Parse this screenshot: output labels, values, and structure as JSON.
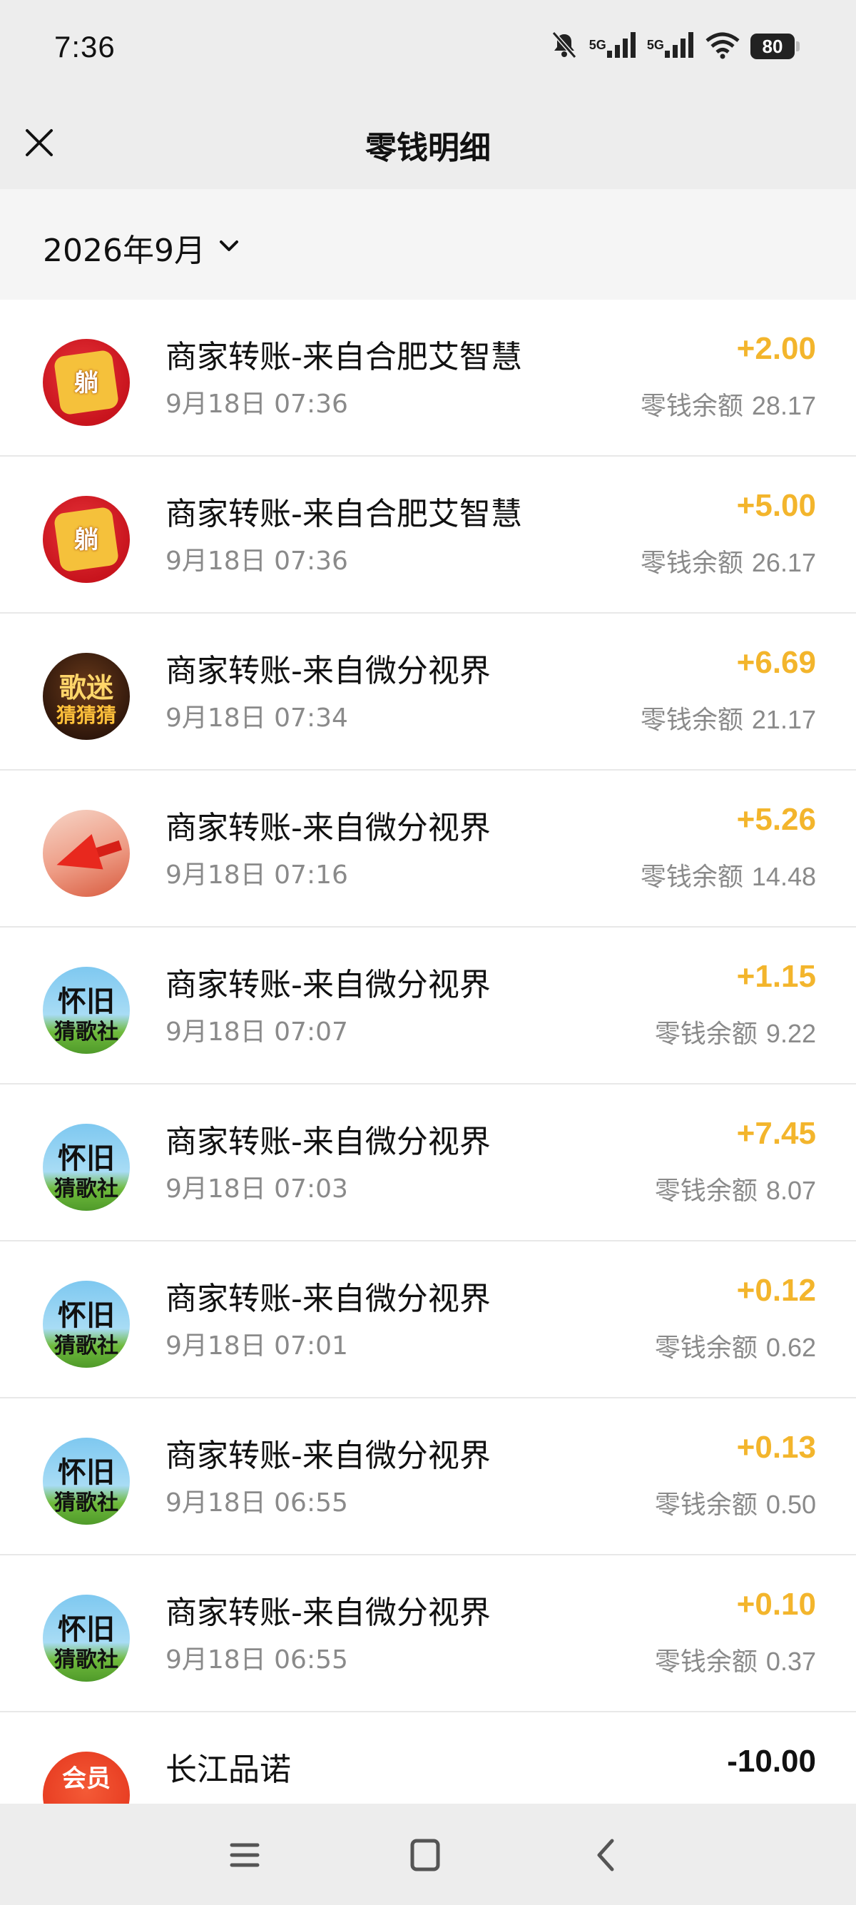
{
  "status_bar": {
    "time": "7:36",
    "network_1": "5G",
    "network_2": "5G",
    "battery": "80"
  },
  "header": {
    "title": "零钱明细"
  },
  "filter": {
    "month": "2026年9月"
  },
  "transactions": [
    {
      "title": "商家转账-来自合肥艾智慧",
      "time": "9月18日 07:36",
      "amount": "+2.00",
      "balance_label": "零钱余额",
      "balance": "28.17",
      "avatar": "red-game-logo",
      "avatar_text": "躺"
    },
    {
      "title": "商家转账-来自合肥艾智慧",
      "time": "9月18日 07:36",
      "amount": "+5.00",
      "balance_label": "零钱余额",
      "balance": "26.17",
      "avatar": "red-game-logo",
      "avatar_text": "躺"
    },
    {
      "title": "商家转账-来自微分视界",
      "time": "9月18日 07:34",
      "amount": "+6.69",
      "balance_label": "零钱余额",
      "balance": "21.17",
      "avatar": "gold-song-logo",
      "avatar_text_1": "歌迷",
      "avatar_text_2": "猜猜猜"
    },
    {
      "title": "商家转账-来自微分视界",
      "time": "9月18日 07:16",
      "amount": "+5.26",
      "balance_label": "零钱余额",
      "balance": "14.48",
      "avatar": "red-arrow-logo"
    },
    {
      "title": "商家转账-来自微分视界",
      "time": "9月18日 07:07",
      "amount": "+1.15",
      "balance_label": "零钱余额",
      "balance": "9.22",
      "avatar": "sky-song-logo",
      "avatar_text_1": "怀旧",
      "avatar_text_2": "猜歌社"
    },
    {
      "title": "商家转账-来自微分视界",
      "time": "9月18日 07:03",
      "amount": "+7.45",
      "balance_label": "零钱余额",
      "balance": "8.07",
      "avatar": "sky-song-logo",
      "avatar_text_1": "怀旧",
      "avatar_text_2": "猜歌社"
    },
    {
      "title": "商家转账-来自微分视界",
      "time": "9月18日 07:01",
      "amount": "+0.12",
      "balance_label": "零钱余额",
      "balance": "0.62",
      "avatar": "sky-song-logo",
      "avatar_text_1": "怀旧",
      "avatar_text_2": "猜歌社"
    },
    {
      "title": "商家转账-来自微分视界",
      "time": "9月18日 06:55",
      "amount": "+0.13",
      "balance_label": "零钱余额",
      "balance": "0.50",
      "avatar": "sky-song-logo",
      "avatar_text_1": "怀旧",
      "avatar_text_2": "猜歌社"
    },
    {
      "title": "商家转账-来自微分视界",
      "time": "9月18日 06:55",
      "amount": "+0.10",
      "balance_label": "零钱余额",
      "balance": "0.37",
      "avatar": "sky-song-logo",
      "avatar_text_1": "怀旧",
      "avatar_text_2": "猜歌社"
    },
    {
      "title": "长江品诺",
      "time": "",
      "amount": "-10.00",
      "balance_label": "",
      "balance": "",
      "avatar": "coral-vip-logo",
      "avatar_text": "会员"
    }
  ],
  "colors": {
    "income": "#f3b52c",
    "expense": "#111111",
    "header_bg": "#ededed"
  },
  "icons": {
    "close": "close-icon",
    "dropdown": "chevron-down-icon",
    "nav_menu": "menu-icon",
    "nav_home": "home-icon",
    "nav_back": "back-icon"
  }
}
